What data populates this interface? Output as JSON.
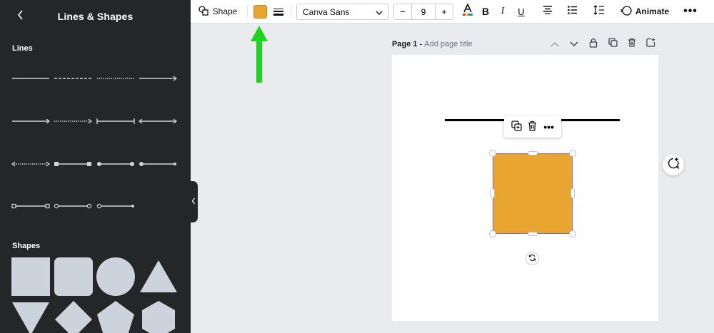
{
  "side_panel": {
    "title": "Lines & Shapes",
    "back_icon": "chevron-left-icon",
    "lines_label": "Lines",
    "shapes_label": "Shapes",
    "line_styles": [
      "solid",
      "dashed",
      "dotted",
      "solid-arrow",
      "solid-arrow",
      "dotted-arrow",
      "bar-ends",
      "double-arrow",
      "dotted-double-arrow",
      "square-ends",
      "circle-ends",
      "circle-end-dot",
      "open-square-ends",
      "open-circle-ends",
      "circle-open-dot"
    ],
    "shape_types": [
      "square",
      "rounded-square",
      "circle",
      "triangle",
      "inverted-triangle",
      "diamond",
      "pentagon",
      "hexagon"
    ],
    "shape_color": "#cdd3dc"
  },
  "toolbar": {
    "shape_label": "Shape",
    "fill_color": "#e8a530",
    "font_name": "Canva Sans",
    "font_size": "9",
    "decrease_label": "−",
    "increase_label": "+",
    "bold_label": "B",
    "italic_label": "I",
    "underline_label": "U",
    "animate_label": "Animate",
    "more_label": "•••"
  },
  "canvas": {
    "page_title": "Page 1",
    "page_title_sep": " - ",
    "page_placeholder": "Add page title",
    "shape_fill": "#e8a530",
    "selection_color": "#8b64b8",
    "context_more": "•••"
  },
  "annotation": {
    "color": "#1ed51e"
  }
}
